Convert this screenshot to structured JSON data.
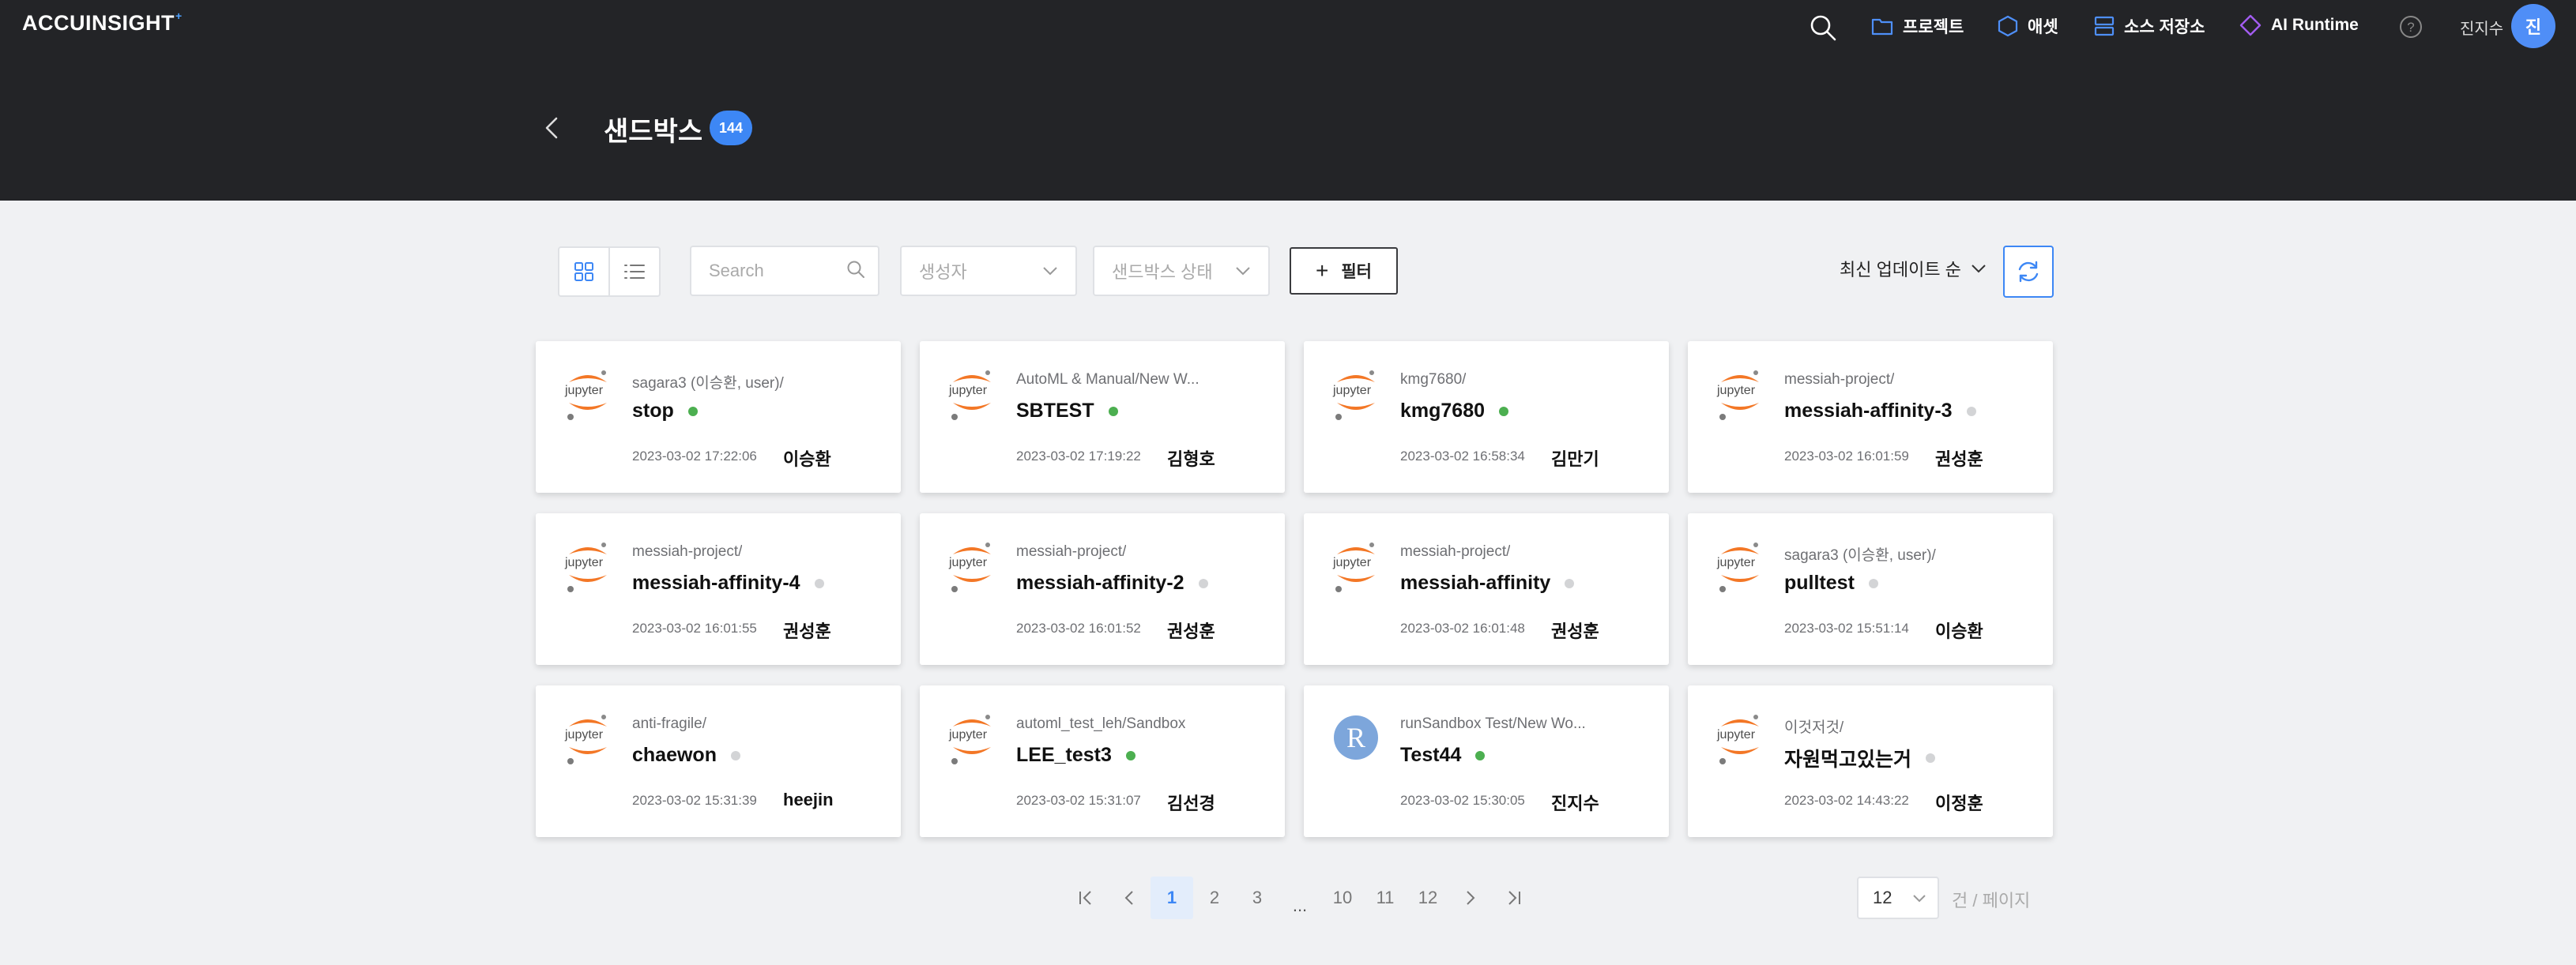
{
  "app": {
    "logo": "ACCUINSIGHT",
    "logo_mark": "+"
  },
  "nav": {
    "items": [
      {
        "label": "프로젝트",
        "icon": "folder-icon"
      },
      {
        "label": "애셋",
        "icon": "hexagon-icon"
      },
      {
        "label": "소스 저장소",
        "icon": "storage-icon"
      },
      {
        "label": "AI Runtime",
        "icon": "diamond-icon"
      }
    ],
    "user_name": "진지수",
    "user_initial": "진"
  },
  "header": {
    "title": "샌드박스",
    "count": "144"
  },
  "toolbar": {
    "search_placeholder": "Search",
    "creator_placeholder": "생성자",
    "status_placeholder": "샌드박스 상태",
    "filter_label": "필터",
    "sort_label": "최신 업데이트 순"
  },
  "cards": [
    {
      "path": "sagara3 (이승환, user)/",
      "name": "stop",
      "status": "running",
      "date": "2023-03-02 17:22:06",
      "owner": "이승환",
      "icon": "jupyter"
    },
    {
      "path": "AutoML & Manual/New W...",
      "name": "SBTEST",
      "status": "running",
      "date": "2023-03-02 17:19:22",
      "owner": "김형호",
      "icon": "jupyter"
    },
    {
      "path": "kmg7680/",
      "name": "kmg7680",
      "status": "running",
      "date": "2023-03-02 16:58:34",
      "owner": "김만기",
      "icon": "jupyter"
    },
    {
      "path": "messiah-project/",
      "name": "messiah-affinity-3",
      "status": "stopped",
      "date": "2023-03-02 16:01:59",
      "owner": "권성훈",
      "icon": "jupyter"
    },
    {
      "path": "messiah-project/",
      "name": "messiah-affinity-4",
      "status": "stopped",
      "date": "2023-03-02 16:01:55",
      "owner": "권성훈",
      "icon": "jupyter"
    },
    {
      "path": "messiah-project/",
      "name": "messiah-affinity-2",
      "status": "stopped",
      "date": "2023-03-02 16:01:52",
      "owner": "권성훈",
      "icon": "jupyter"
    },
    {
      "path": "messiah-project/",
      "name": "messiah-affinity",
      "status": "stopped",
      "date": "2023-03-02 16:01:48",
      "owner": "권성훈",
      "icon": "jupyter"
    },
    {
      "path": "sagara3 (이승환, user)/",
      "name": "pulltest",
      "status": "stopped",
      "date": "2023-03-02 15:51:14",
      "owner": "이승환",
      "icon": "jupyter"
    },
    {
      "path": "anti-fragile/",
      "name": "chaewon",
      "status": "stopped",
      "date": "2023-03-02 15:31:39",
      "owner": "heejin",
      "icon": "jupyter"
    },
    {
      "path": "automl_test_leh/Sandbox",
      "name": "LEE_test3",
      "status": "running",
      "date": "2023-03-02 15:31:07",
      "owner": "김선경",
      "icon": "jupyter"
    },
    {
      "path": "runSandbox Test/New Wo...",
      "name": "Test44",
      "status": "running",
      "date": "2023-03-02 15:30:05",
      "owner": "진지수",
      "icon": "r"
    },
    {
      "path": "이것저것/",
      "name": "자원먹고있는거",
      "status": "stopped",
      "date": "2023-03-02 14:43:22",
      "owner": "이정훈",
      "icon": "jupyter"
    }
  ],
  "pagination": {
    "pages": [
      "1",
      "2",
      "3",
      "...",
      "10",
      "11",
      "12"
    ],
    "current": "1",
    "page_size": "12",
    "page_size_suffix": "건 / 페이지"
  },
  "colors": {
    "accent": "#3d87f5",
    "running": "#4caf50",
    "stopped": "#d3d4d6",
    "header_bg": "#232427",
    "jupyter_orange": "#f37726"
  }
}
